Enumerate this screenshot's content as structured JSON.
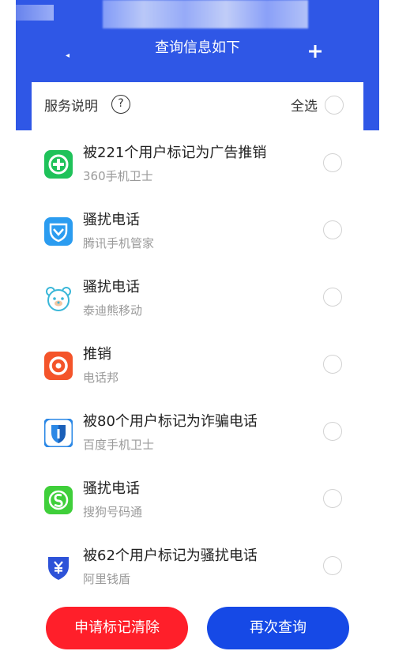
{
  "header": {
    "title": "查询信息如下",
    "plus_symbol": "+",
    "back_symbol": "◂"
  },
  "card": {
    "service_label": "服务说明",
    "help_symbol": "?",
    "select_all_label": "全选"
  },
  "items": [
    {
      "title": "被221个用户标记为广告推销",
      "source": "360手机卫士",
      "icon": "plus-shield-icon"
    },
    {
      "title": "骚扰电话",
      "source": "腾讯手机管家",
      "icon": "tencent-shield-icon"
    },
    {
      "title": "骚扰电话",
      "source": "泰迪熊移动",
      "icon": "teddy-bear-icon"
    },
    {
      "title": "推销",
      "source": "电话邦",
      "icon": "ring-phone-icon"
    },
    {
      "title": "被80个用户标记为诈骗电话",
      "source": "百度手机卫士",
      "icon": "baidu-shield-icon"
    },
    {
      "title": "骚扰电话",
      "source": "搜狗号码通",
      "icon": "phone-s-icon"
    },
    {
      "title": "被62个用户标记为骚扰电话",
      "source": "阿里钱盾",
      "icon": "yuan-shield-icon"
    }
  ],
  "buttons": {
    "clear_label": "申请标记清除",
    "query_label": "再次查询"
  },
  "colors": {
    "header_blue": "#2f57e6",
    "clear_red": "#ff1f2a",
    "query_blue": "#1649e6"
  }
}
